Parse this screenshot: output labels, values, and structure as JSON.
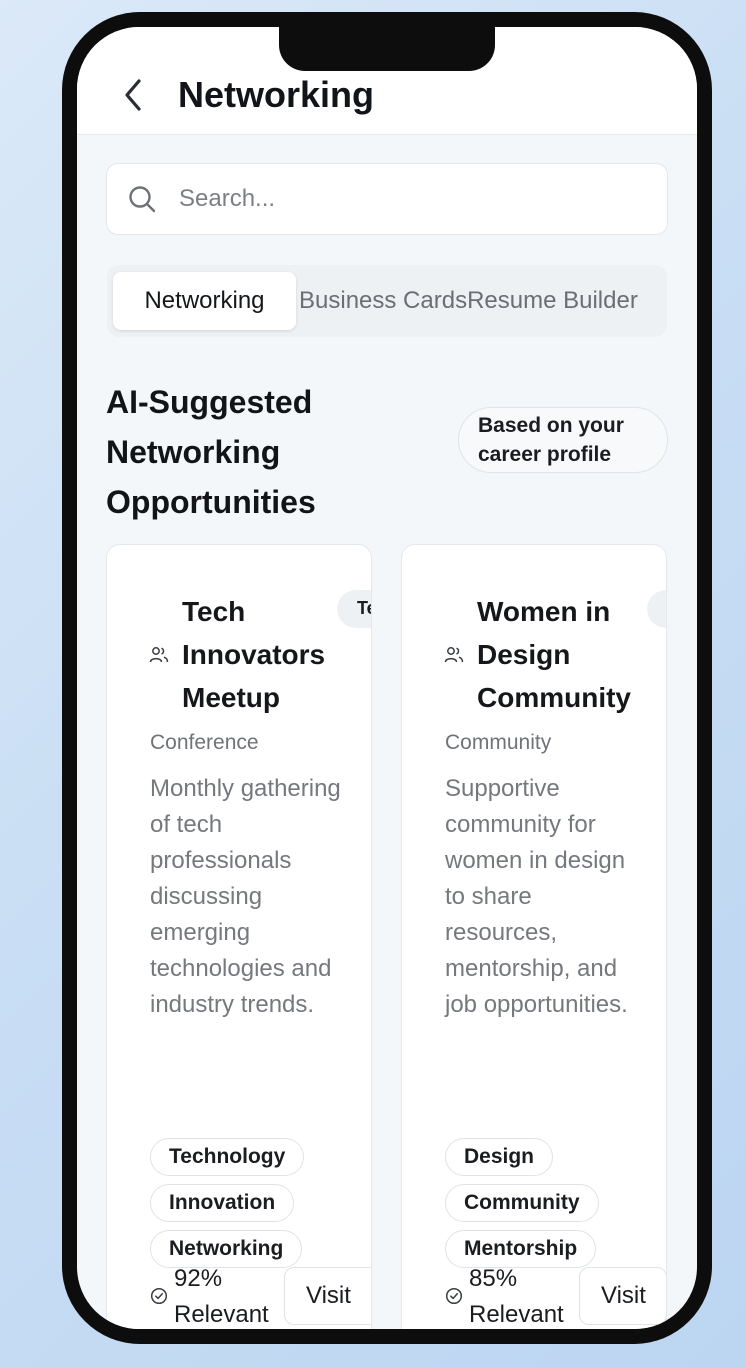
{
  "header": {
    "title": "Networking"
  },
  "search": {
    "placeholder": "Search..."
  },
  "tabs": [
    {
      "label": "Networking",
      "active": true
    },
    {
      "label": "Business Cards",
      "active": false
    },
    {
      "label": "Resume Builder",
      "active": false
    }
  ],
  "section": {
    "title": "AI-Suggested Networking Opportunities",
    "badge": "Based on your career profile"
  },
  "cards": [
    {
      "title": "Tech Innovators Meetup",
      "pill": "Te",
      "type": "Conference",
      "description": "Monthly gathering of tech professionals discussing emerging technologies and industry trends.",
      "tags": [
        "Technology",
        "Innovation",
        "Networking"
      ],
      "relevance": "92% Relevant",
      "visit_label": "Visit"
    },
    {
      "title": "Women in Design Community",
      "pill": "",
      "type": "Community",
      "description": "Supportive community for women in design to share resources, mentorship, and job opportunities.",
      "tags": [
        "Design",
        "Community",
        "Mentorship"
      ],
      "relevance": "85% Relevant",
      "visit_label": "Visit"
    }
  ],
  "icons": {
    "back": "chevron-left-icon",
    "search": "search-icon",
    "card_type": "people-icon",
    "relevance": "check-circle-icon"
  }
}
